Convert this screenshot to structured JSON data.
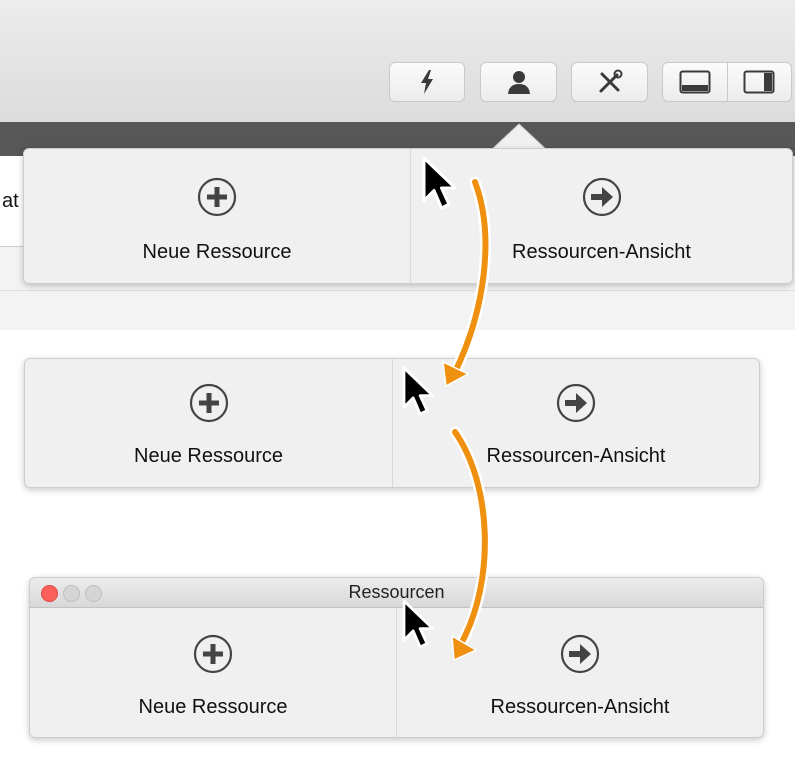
{
  "panels": [
    {
      "new_label": "Neue Ressource",
      "view_label": "Ressourcen-Ansicht"
    },
    {
      "new_label": "Neue Ressource",
      "view_label": "Ressourcen-Ansicht"
    },
    {
      "new_label": "Neue Ressource",
      "view_label": "Ressourcen-Ansicht"
    }
  ],
  "background_window": {
    "partial_text": "at"
  },
  "window": {
    "title": "Ressourcen"
  },
  "toolbar": {
    "icons": [
      "lightning-icon",
      "person-icon",
      "tools-icon",
      "bottom-panel-icon",
      "side-panel-icon"
    ]
  },
  "colors": {
    "arrow": "#F0900F",
    "close": "#FC605C",
    "inactive": "#D5D5D5"
  }
}
